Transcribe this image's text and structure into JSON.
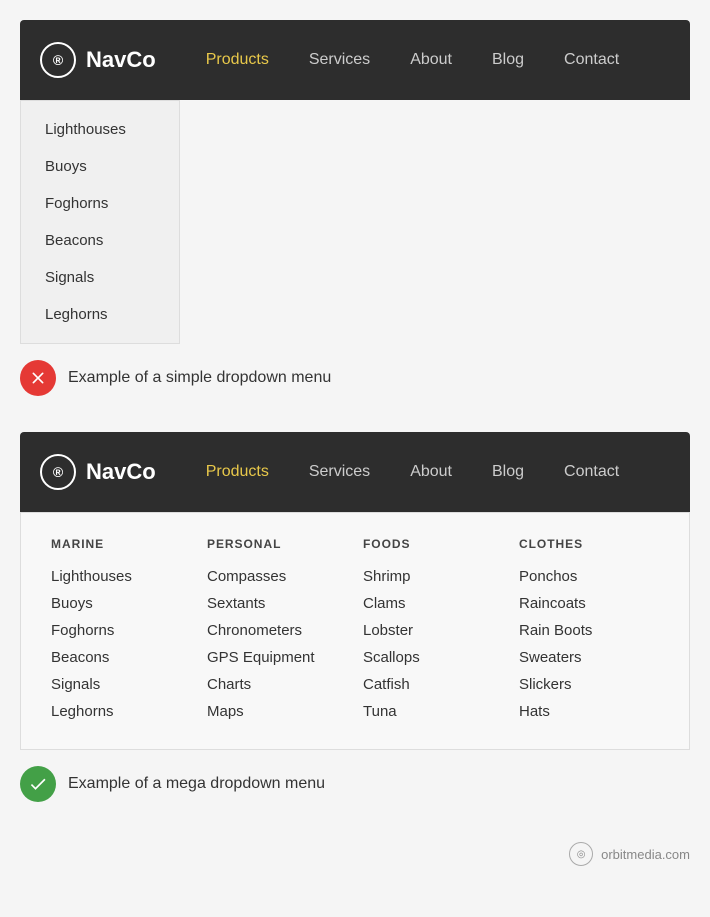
{
  "brand": {
    "logo_icon": "®",
    "name": "NavCo"
  },
  "nav1": {
    "links": [
      {
        "label": "Products",
        "active": true
      },
      {
        "label": "Services",
        "active": false
      },
      {
        "label": "About",
        "active": false
      },
      {
        "label": "Blog",
        "active": false
      },
      {
        "label": "Contact",
        "active": false
      }
    ],
    "dropdown": {
      "items": [
        "Lighthouses",
        "Buoys",
        "Foghorns",
        "Beacons",
        "Signals",
        "Leghorns"
      ]
    }
  },
  "example1": {
    "label": "Example of a simple dropdown menu",
    "type": "bad"
  },
  "nav2": {
    "links": [
      {
        "label": "Products",
        "active": true
      },
      {
        "label": "Services",
        "active": false
      },
      {
        "label": "About",
        "active": false
      },
      {
        "label": "Blog",
        "active": false
      },
      {
        "label": "Contact",
        "active": false
      }
    ],
    "mega": {
      "columns": [
        {
          "header": "MARINE",
          "items": [
            "Lighthouses",
            "Buoys",
            "Foghorns",
            "Beacons",
            "Signals",
            "Leghorns"
          ]
        },
        {
          "header": "PERSONAL",
          "items": [
            "Compasses",
            "Sextants",
            "Chronometers",
            "GPS Equipment",
            "Charts",
            "Maps"
          ]
        },
        {
          "header": "FOODS",
          "items": [
            "Shrimp",
            "Clams",
            "Lobster",
            "Scallops",
            "Catfish",
            "Tuna"
          ]
        },
        {
          "header": "CLOTHES",
          "items": [
            "Ponchos",
            "Raincoats",
            "Rain Boots",
            "Sweaters",
            "Slickers",
            "Hats"
          ]
        }
      ]
    }
  },
  "example2": {
    "label": "Example of a mega dropdown menu",
    "type": "good"
  },
  "footer": {
    "text": "orbitmedia.com"
  }
}
